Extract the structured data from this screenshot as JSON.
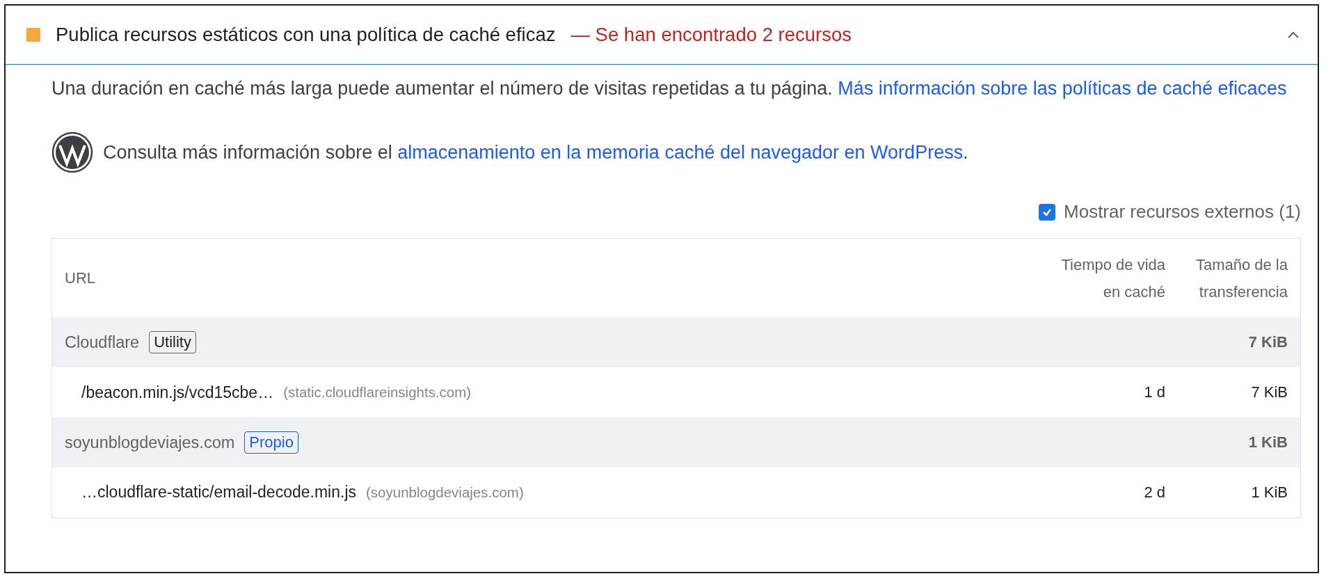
{
  "audit": {
    "color": "#f4a83d",
    "title": "Publica recursos estáticos con una política de caché eficaz",
    "display_value": "— Se han encontrado 2 recursos",
    "expanded": true
  },
  "description": {
    "text": "Una duración en caché más larga puede aumentar el número de visitas repetidas a tu página. ",
    "link": "Más información sobre las políticas de caché eficaces"
  },
  "wordpress_note": {
    "text": "Consulta más información sobre el ",
    "link": "almacenamiento en la memoria caché del navegador en WordPress",
    "suffix": "."
  },
  "third_party_filter": {
    "label": "Mostrar recursos externos (1)",
    "checked": true
  },
  "table": {
    "columns": [
      "URL",
      "Tiempo de vida en caché",
      "Tamaño de la transferencia"
    ],
    "groups": [
      {
        "entity": "Cloudflare",
        "tag": "Utility",
        "first_party": false,
        "size": "7 KiB",
        "rows": [
          {
            "url": "/beacon.min.js/vcd15cbe…",
            "host": "(static.cloudflareinsights.com)",
            "ttl": "1 d",
            "size": "7 KiB"
          }
        ]
      },
      {
        "entity": "soyunblogdeviajes.com",
        "tag": "Propio",
        "first_party": true,
        "size": "1 KiB",
        "rows": [
          {
            "url": "…cloudflare-static/email-decode.min.js",
            "host": "(soyunblogdeviajes.com)",
            "ttl": "2 d",
            "size": "1 KiB"
          }
        ]
      }
    ]
  }
}
